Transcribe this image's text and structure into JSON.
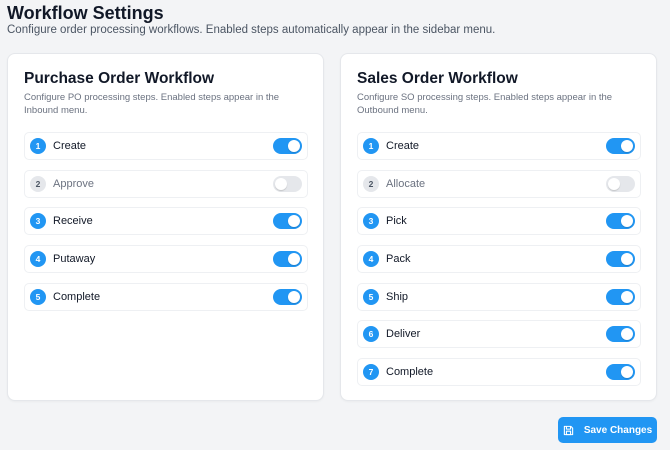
{
  "header": {
    "title": "Workflow Settings",
    "subtitle": "Configure order processing workflows. Enabled steps automatically appear in the sidebar menu."
  },
  "purchase_order": {
    "title": "Purchase Order Workflow",
    "description": "Configure PO processing steps. Enabled steps appear in the Inbound menu.",
    "steps": [
      {
        "number": "1",
        "label": "Create",
        "enabled": true
      },
      {
        "number": "2",
        "label": "Approve",
        "enabled": false
      },
      {
        "number": "3",
        "label": "Receive",
        "enabled": true
      },
      {
        "number": "4",
        "label": "Putaway",
        "enabled": true
      },
      {
        "number": "5",
        "label": "Complete",
        "enabled": true
      }
    ]
  },
  "sales_order": {
    "title": "Sales Order Workflow",
    "description": "Configure SO processing steps. Enabled steps appear in the Outbound menu.",
    "steps": [
      {
        "number": "1",
        "label": "Create",
        "enabled": true
      },
      {
        "number": "2",
        "label": "Allocate",
        "enabled": false
      },
      {
        "number": "3",
        "label": "Pick",
        "enabled": true
      },
      {
        "number": "4",
        "label": "Pack",
        "enabled": true
      },
      {
        "number": "5",
        "label": "Ship",
        "enabled": true
      },
      {
        "number": "6",
        "label": "Deliver",
        "enabled": true
      },
      {
        "number": "7",
        "label": "Complete",
        "enabled": true
      }
    ]
  },
  "actions": {
    "save_label": "Save Changes",
    "save_icon": "save-icon"
  },
  "colors": {
    "accent": "#2196f3",
    "toggle_off": "#e5e7eb"
  }
}
